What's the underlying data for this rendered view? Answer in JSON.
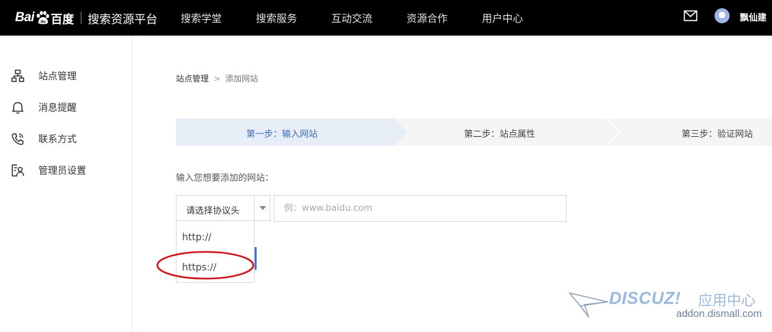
{
  "header": {
    "logo_text_bai": "Bai",
    "logo_text_baidu_cn": "百度",
    "logo_subtitle": "搜索资源平台",
    "nav": [
      "搜索学堂",
      "搜索服务",
      "互动交流",
      "资源合作",
      "用户中心"
    ],
    "user_name": "飘仙建"
  },
  "sidebar": {
    "items": [
      {
        "label": "站点管理",
        "icon": "sitemap-icon"
      },
      {
        "label": "消息提醒",
        "icon": "bell-icon"
      },
      {
        "label": "联系方式",
        "icon": "phone-icon"
      },
      {
        "label": "管理员设置",
        "icon": "admin-settings-icon"
      }
    ]
  },
  "breadcrumb": {
    "parent": "站点管理",
    "separator": ">",
    "current": "添加网站"
  },
  "steps": [
    {
      "label": "第一步：输入网站",
      "active": true
    },
    {
      "label": "第二步：站点属性",
      "active": false
    },
    {
      "label": "第三步：验证网站",
      "active": false
    }
  ],
  "form": {
    "prompt": "输入您想要添加的网站：",
    "protocol_select": {
      "selected_label": "请选择协议头",
      "options": [
        "http://",
        "https://"
      ]
    },
    "url_input": {
      "value": "",
      "placeholder": "例：www.baidu.com"
    }
  },
  "watermark": {
    "brand": "DISCUZ!",
    "cn": "应用中心",
    "domain": "addon.dismall.com"
  },
  "colors": {
    "topbar_bg": "#000000",
    "accent_blue": "#3b6cb8",
    "active_step_bg": "#e8eef8",
    "highlight_red": "#d0141c"
  }
}
